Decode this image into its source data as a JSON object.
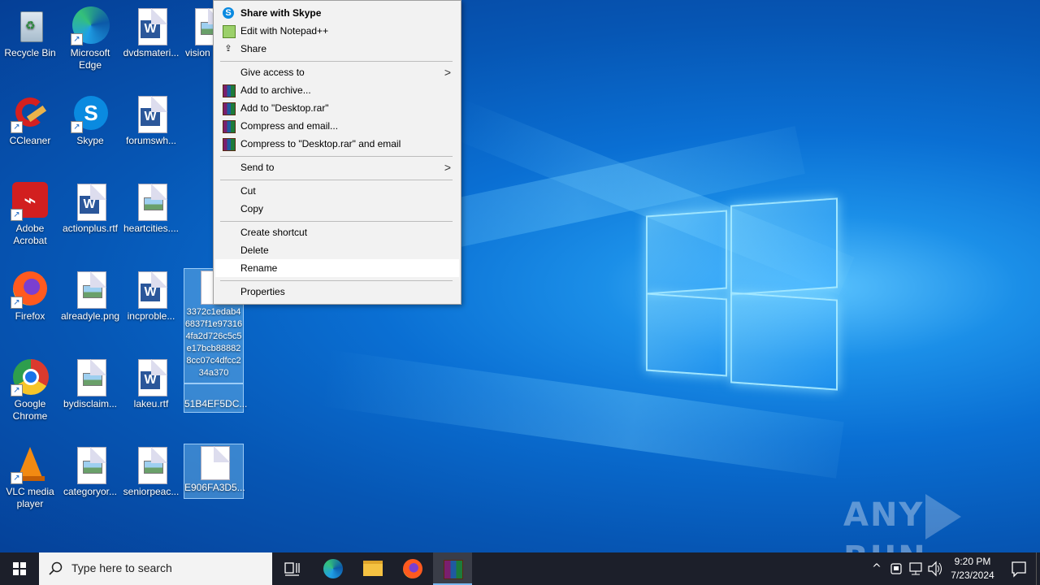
{
  "desktop_icons": [
    {
      "label": "Recycle Bin",
      "icon": "recycle-bin-icon"
    },
    {
      "label": "Microsoft Edge",
      "icon": "edge-icon"
    },
    {
      "label": "dvdsmateri...",
      "icon": "word-doc-icon"
    },
    {
      "label": "vision",
      "icon": "image-file-icon"
    },
    {
      "label": "CCleaner",
      "icon": "ccleaner-icon"
    },
    {
      "label": "Skype",
      "icon": "skype-icon"
    },
    {
      "label": "forumswh...",
      "icon": "word-doc-icon"
    },
    {
      "label": "Adobe Acrobat",
      "icon": "acrobat-icon"
    },
    {
      "label": "actionplus.rtf",
      "icon": "word-doc-icon"
    },
    {
      "label": "heartcities....",
      "icon": "image-file-icon"
    },
    {
      "label": "Firefox",
      "icon": "firefox-icon"
    },
    {
      "label": "alreadyle.png",
      "icon": "image-file-icon"
    },
    {
      "label": "incproble...",
      "icon": "word-doc-icon"
    },
    {
      "label": "3372c1edab46837f1e973164fa2d726c5c5e17bcb888828cc07c4dfcc234a370",
      "icon": "blank-file-icon"
    },
    {
      "label": "Google Chrome",
      "icon": "chrome-icon"
    },
    {
      "label": "bydisclaim...",
      "icon": "image-file-icon"
    },
    {
      "label": "lakeu.rtf",
      "icon": "word-doc-icon"
    },
    {
      "label": "51B4EF5DC...",
      "icon": "blank-file-icon"
    },
    {
      "label": "VLC media player",
      "icon": "vlc-icon"
    },
    {
      "label": "categoryor...",
      "icon": "image-file-icon"
    },
    {
      "label": "seniorpeac...",
      "icon": "image-file-icon"
    },
    {
      "label": "E906FA3D5...",
      "icon": "blank-file-icon"
    }
  ],
  "context_menu": {
    "items": [
      {
        "label": "Share with Skype",
        "icon": "skype-icon"
      },
      {
        "label": "Edit with Notepad++",
        "icon": "notepadpp-icon"
      },
      {
        "label": "Share",
        "icon": "share-icon"
      },
      {
        "label": "Give access to",
        "icon": ""
      },
      {
        "label": "Add to archive...",
        "icon": "winrar-icon"
      },
      {
        "label": "Add to \"Desktop.rar\"",
        "icon": "winrar-icon"
      },
      {
        "label": "Compress and email...",
        "icon": "winrar-icon"
      },
      {
        "label": "Compress to \"Desktop.rar\" and email",
        "icon": "winrar-icon"
      },
      {
        "label": "Send to",
        "icon": ""
      },
      {
        "label": "Cut",
        "icon": ""
      },
      {
        "label": "Copy",
        "icon": ""
      },
      {
        "label": "Create shortcut",
        "icon": ""
      },
      {
        "label": "Delete",
        "icon": ""
      },
      {
        "label": "Rename",
        "icon": ""
      },
      {
        "label": "Properties",
        "icon": ""
      }
    ],
    "highlighted": "Rename"
  },
  "taskbar": {
    "search_placeholder": "Type here to search",
    "time": "9:20 PM",
    "date": "7/23/2024"
  },
  "watermark": {
    "left": "ANY",
    "right": "RUN"
  }
}
